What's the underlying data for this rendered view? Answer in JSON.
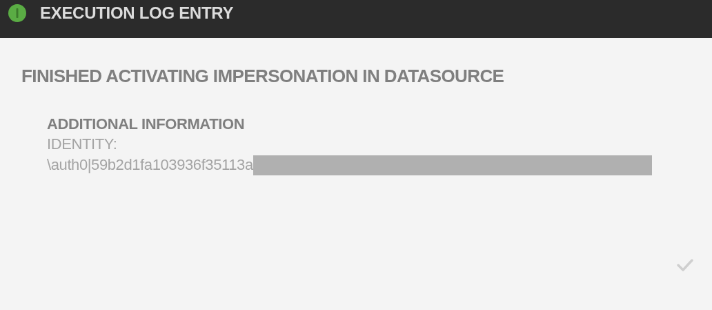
{
  "header": {
    "title": "EXECUTION LOG ENTRY"
  },
  "entry": {
    "message": "FINISHED ACTIVATING IMPERSONATION IN DATASOURCE",
    "details_heading": "ADDITIONAL INFORMATION",
    "identity_label": "IDENTITY:",
    "identity_value": "\\auth0|59b2d1fa103936f35113a",
    "identity_redacted": true
  },
  "footer": {
    "confirm": true
  }
}
